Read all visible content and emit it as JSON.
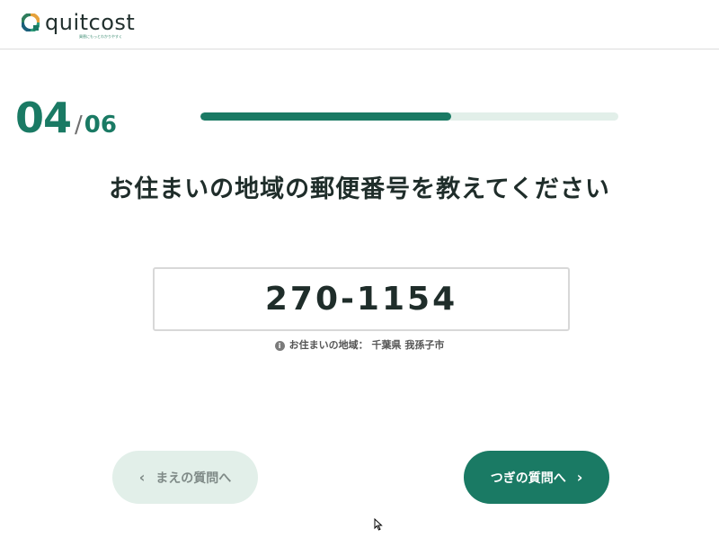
{
  "header": {
    "logo_text": "quitcost",
    "logo_tagline": "買替にもっとわかりやすく",
    "brand_color": "#1a7a64"
  },
  "step": {
    "current": "04",
    "separator": "/",
    "total": "06"
  },
  "progress": {
    "fraction": 0.6
  },
  "question": "お住まいの地域の郵便番号を教えてください",
  "zip_input": {
    "value": "270-1154"
  },
  "hint": {
    "icon": "info-icon",
    "label": "お住まいの地域：",
    "region": "千葉県 我孫子市"
  },
  "buttons": {
    "prev_label": "まえの質問へ",
    "next_label": "つぎの質問へ"
  },
  "colors": {
    "accent": "#1a7a64",
    "accent_light": "#e2efe9",
    "text": "#1f2d2a"
  }
}
